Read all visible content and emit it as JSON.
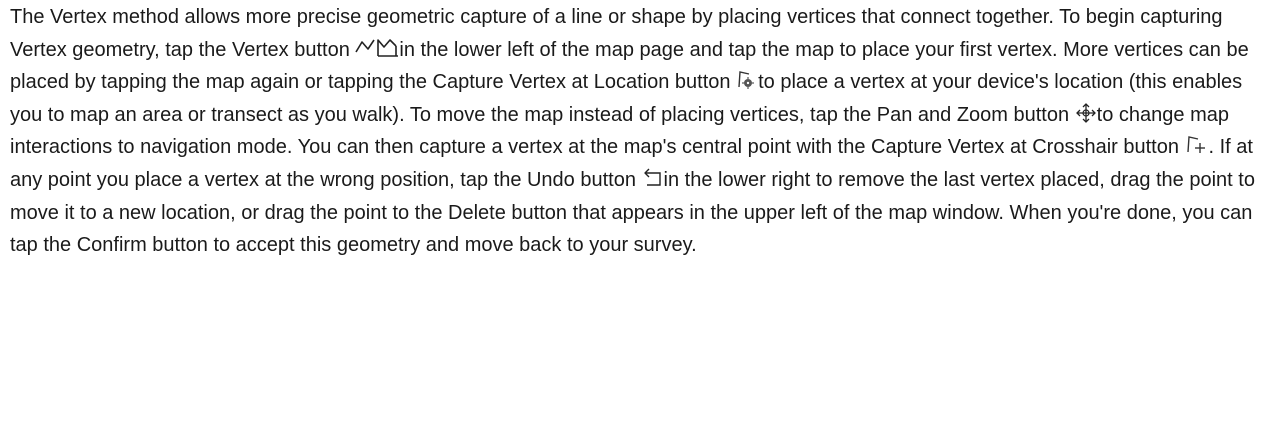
{
  "paragraph": {
    "s1": "The Vertex method allows more precise geometric capture of a line or shape by placing vertices that connect together. To begin capturing Vertex geometry, tap the Vertex button ",
    "s2": "in the lower left of the map page and tap the map to place your first vertex. More vertices can be placed by tapping the map again or tapping the Capture Vertex at Location button ",
    "s3": "to place a vertex at your device's location (this enables you to map an area or transect as you walk). To move the map instead of placing vertices, tap the Pan and Zoom button ",
    "s4": "to change map interactions to navigation mode. You can then capture a vertex at the map's central point with the Capture Vertex at Crosshair button ",
    "s5": ". If at any point you place a vertex at the wrong position, tap the Undo button ",
    "s6": "in the lower right to remove the last vertex placed, drag the point to move it to a new location, or drag the point to the Delete button that appears in the upper left of the map window. When you're done, you can tap the Confirm button to accept this geometry and move back to your survey."
  },
  "icons": {
    "vertex": "vertex-line-polygon-icon",
    "capture_location": "capture-vertex-at-location-icon",
    "pan_zoom": "pan-and-zoom-icon",
    "capture_crosshair": "capture-vertex-at-crosshair-icon",
    "undo": "undo-icon"
  }
}
